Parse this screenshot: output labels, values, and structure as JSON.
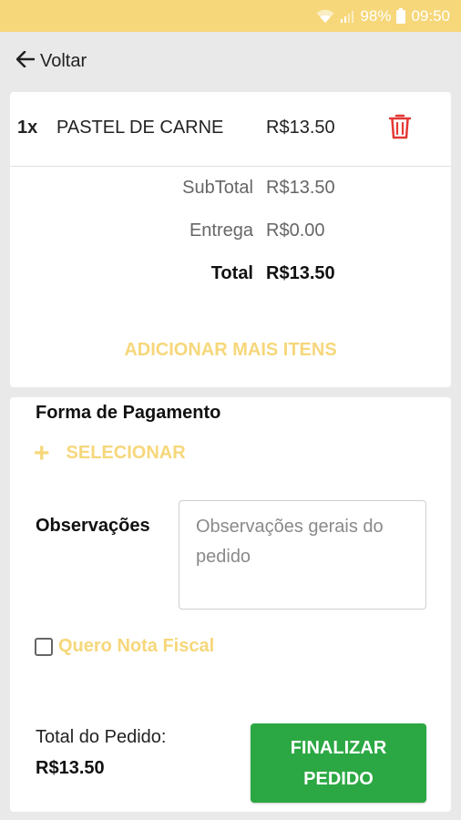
{
  "status_bar": {
    "battery": "98%",
    "time": "09:50"
  },
  "topbar": {
    "back_label": "Voltar"
  },
  "order": {
    "items": [
      {
        "qty": "1x",
        "name": "PASTEL DE CARNE",
        "price": "R$13.50"
      }
    ],
    "subtotal_label": "SubTotal",
    "subtotal_value": "R$13.50",
    "delivery_label": "Entrega",
    "delivery_value": "R$0.00",
    "total_label": "Total",
    "total_value": "R$13.50",
    "add_more_label": "ADICIONAR MAIS ITENS"
  },
  "payment": {
    "title": "Forma de Pagamento",
    "select_label": "SELECIONAR"
  },
  "observations": {
    "label": "Observações",
    "placeholder": "Observações gerais do pedido",
    "value": ""
  },
  "invoice": {
    "label": "Quero Nota Fiscal",
    "checked": false
  },
  "footer": {
    "total_label": "Total do Pedido:",
    "total_value": "R$13.50",
    "finalize_line1": "FINALIZAR",
    "finalize_line2": "PEDIDO"
  },
  "colors": {
    "accent": "#f6d77a",
    "primary_button": "#2ba843",
    "trash": "#e53935"
  },
  "icons": {
    "back": "arrow-left-icon",
    "trash": "trash-icon",
    "plus": "plus-icon",
    "wifi": "wifi-icon",
    "signal": "signal-icon",
    "battery": "battery-icon"
  }
}
